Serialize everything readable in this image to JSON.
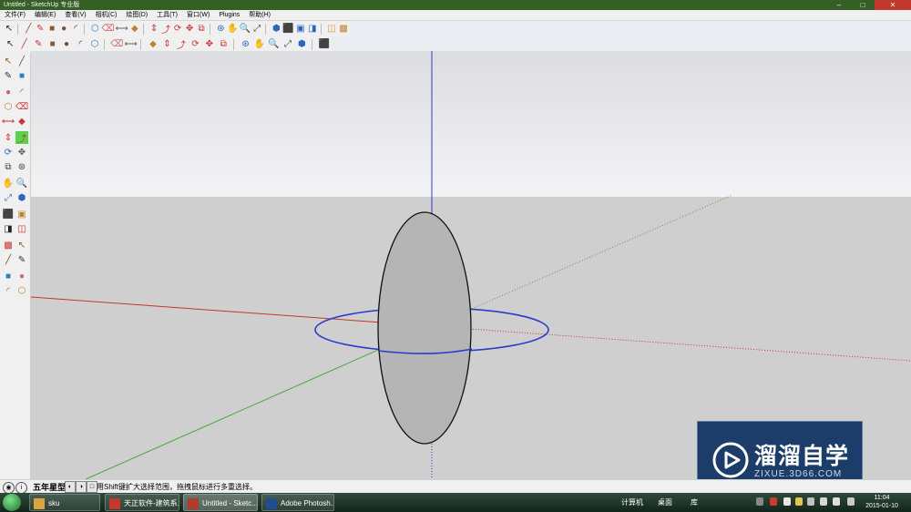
{
  "window": {
    "title": "Untitled - SketchUp 专业版",
    "controls": [
      "–",
      "□",
      "✕"
    ]
  },
  "menu": {
    "items": [
      "文件(F)",
      "编辑(E)",
      "查看(V)",
      "相机(C)",
      "绘图(D)",
      "工具(T)",
      "窗口(W)",
      "Plugins",
      "帮助(H)"
    ]
  },
  "status": {
    "hint": "用Shift键扩大选择范围，拖拽鼠标进行多重选择。",
    "label": "五年星型"
  },
  "watermark": {
    "title": "溜溜自学",
    "subtitle": "ZIXUE.3D66.COM"
  },
  "taskbar": {
    "items": [
      {
        "label": "sku",
        "color": "#d9a441"
      },
      {
        "label": "天正软件-建筑系...",
        "color": "#c0392b"
      },
      {
        "label": "Untitled - Sketc...",
        "color": "#b33a2e"
      },
      {
        "label": "Adobe Photosh...",
        "color": "#1f4f8f"
      }
    ],
    "tray_computer": "计算机",
    "tray_desktop": "桌面",
    "tray_library": "库",
    "clock_time": "11:04",
    "clock_date": "2015-01-10"
  },
  "icons": {
    "top_row_1": [
      "select-icon",
      "line-icon",
      "freehand-icon",
      "rectangle-icon",
      "circle-icon",
      "arc-icon",
      "make-component-icon",
      "eraser-icon",
      "tape-measure-icon",
      "paint-bucket-icon",
      "push-pull-icon",
      "follow-me-icon",
      "rotate-icon",
      "move-icon",
      "offset-icon",
      "orbit-icon",
      "pan-icon",
      "zoom-icon",
      "zoom-extents-icon",
      "iso-view-icon",
      "top-view-icon",
      "front-view-icon",
      "right-view-icon",
      "component-browser-icon",
      "materials-icon"
    ],
    "top_row_2": [
      "wireframe-icon",
      "hidden-line-icon",
      "shaded-icon",
      "textured-icon",
      "monochrome-icon",
      "xray-icon",
      "back-edges-icon",
      "section-plane-icon",
      "section-cut-icon",
      "sandbox-icon",
      "stamp-icon",
      "drape-icon",
      "smoove-icon",
      "flip-edge-icon",
      "add-detail-icon",
      "walk-icon",
      "look-around-icon",
      "position-camera-icon",
      "previous-view-icon",
      "next-view-icon",
      "su-logo-icon"
    ],
    "left_col": [
      "select-icon",
      "make-component-icon",
      "paint-bucket-icon",
      "eraser-icon",
      "rectangle-icon",
      "line-icon",
      "circle-icon",
      "arc-icon",
      "polygon-icon",
      "freehand-icon",
      "move-icon",
      "push-pull-icon",
      "rotate-icon",
      "follow-me-icon",
      "scale-icon",
      "offset-icon",
      "tape-measure-icon",
      "dimension-icon",
      "protractor-icon",
      "text-icon",
      "axes-icon",
      "3d-text-icon",
      "orbit-icon",
      "pan-icon",
      "zoom-icon",
      "zoom-window-icon",
      "zoom-extents-icon",
      "previous-icon",
      "position-camera-icon",
      "look-around-icon",
      "walk-icon",
      "section-plane-icon"
    ]
  },
  "colors": {
    "red_axis": "#c0392b",
    "green_axis": "#47a83a",
    "blue_axis": "#2b3bcc",
    "sky": "#ececef",
    "ground": "#cfcfcf"
  }
}
